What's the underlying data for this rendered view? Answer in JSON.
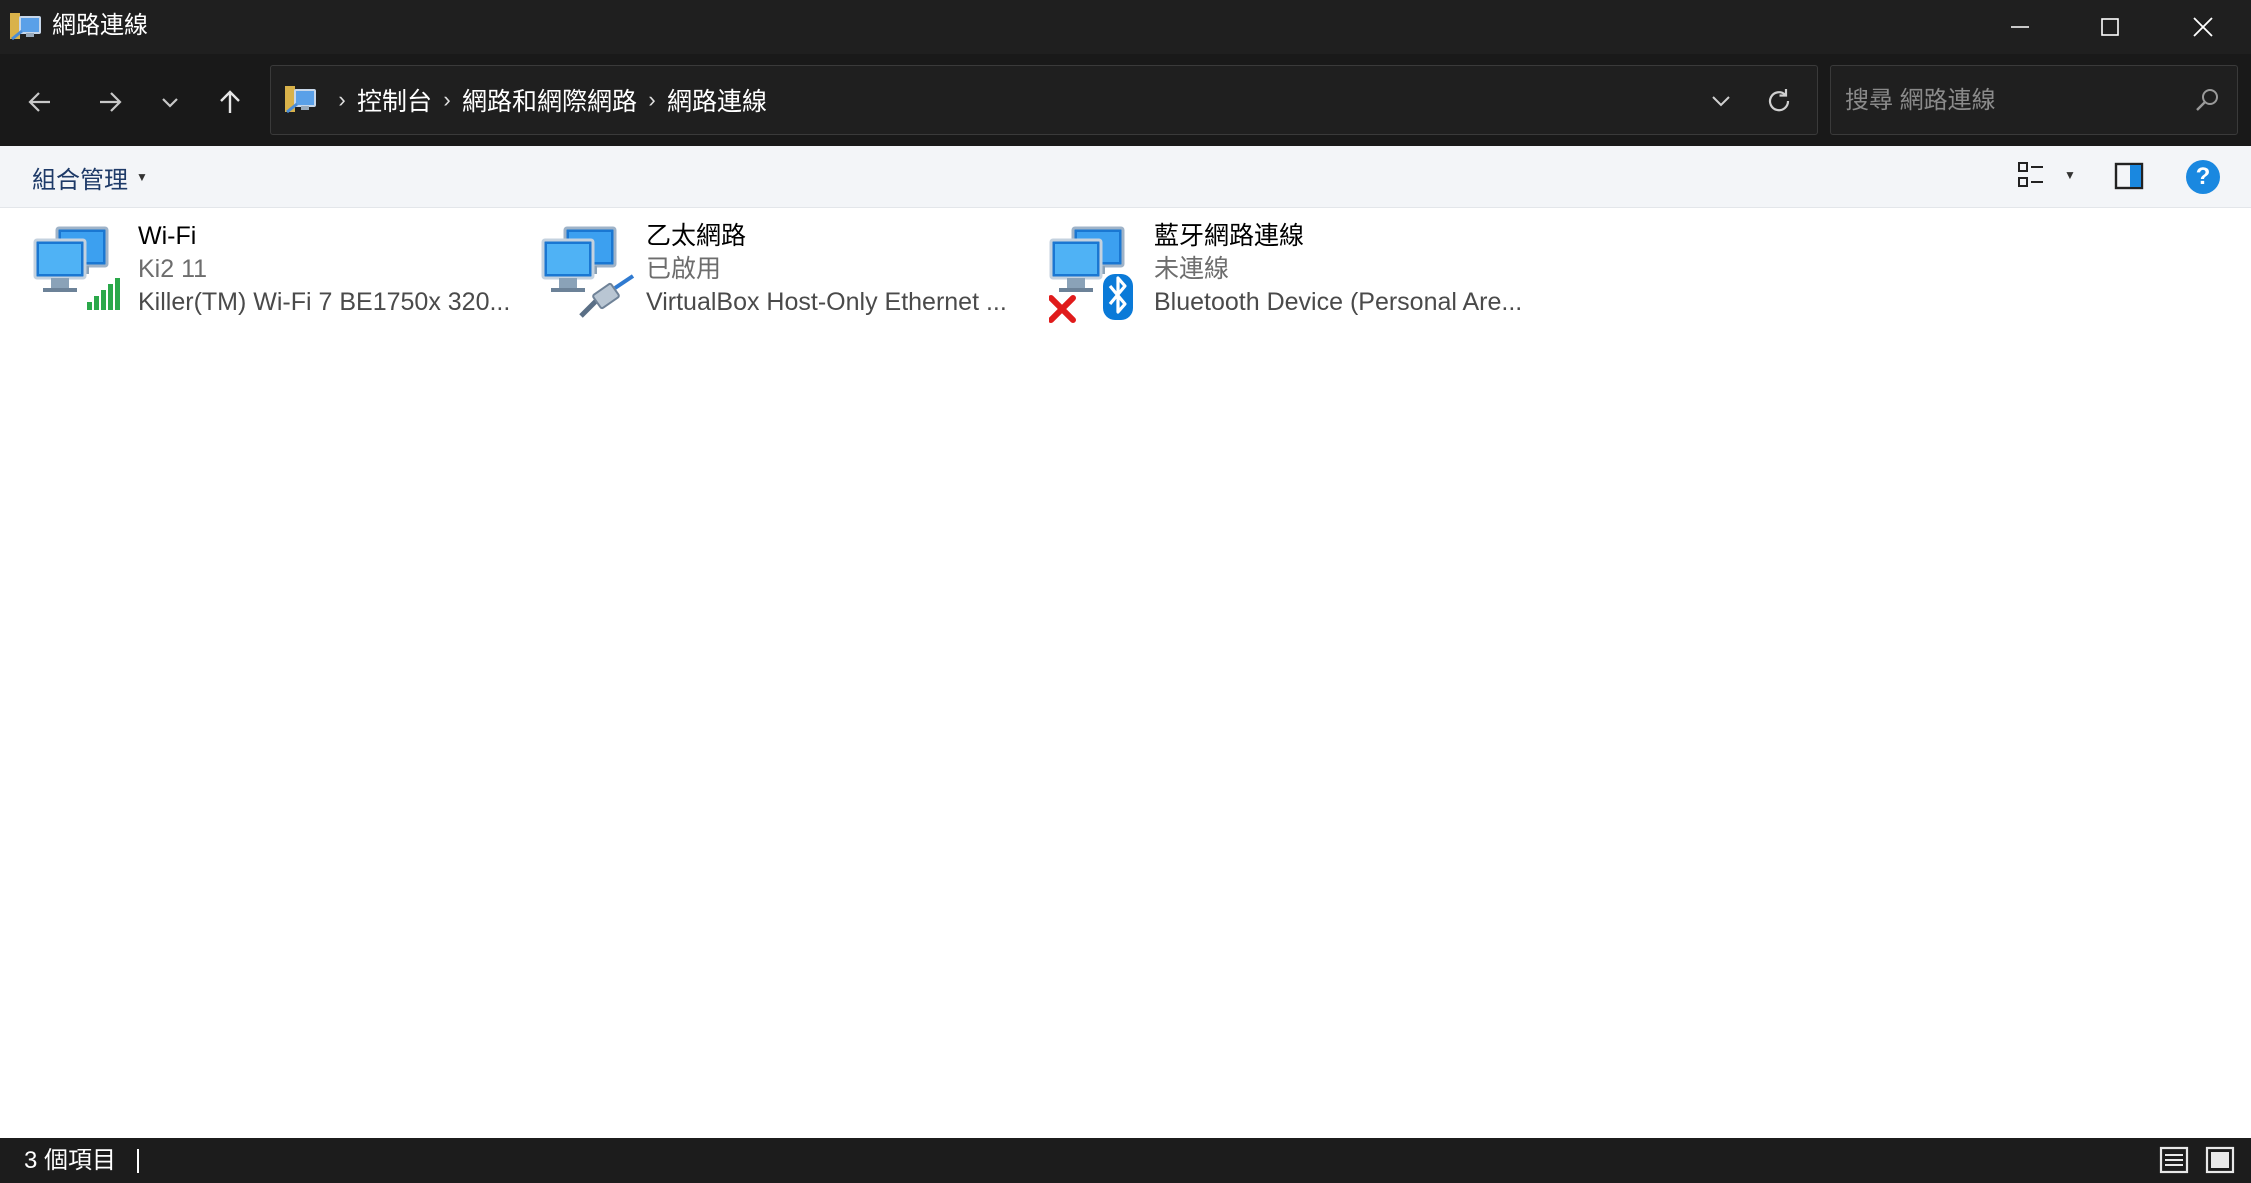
{
  "window": {
    "title": "網路連線",
    "minimize_label": "Minimize",
    "maximize_label": "Maximize",
    "close_label": "Close"
  },
  "nav": {
    "back_label": "Back",
    "forward_label": "Forward",
    "recent_label": "Recent locations",
    "up_label": "Up"
  },
  "breadcrumbs": [
    "控制台",
    "網路和網際網路",
    "網路連線"
  ],
  "search": {
    "placeholder": "搜尋 網路連線"
  },
  "toolbar": {
    "organize_label": "組合管理",
    "help_label": "?"
  },
  "connections": [
    {
      "name": "Wi-Fi",
      "status": "Ki2 11",
      "device": "Killer(TM) Wi-Fi 7 BE1750x 320...",
      "icon": "wifi-adapter-icon",
      "overlay": "signal-bars-icon"
    },
    {
      "name": "乙太網路",
      "status": "已啟用",
      "device": "VirtualBox Host-Only Ethernet ...",
      "icon": "ethernet-adapter-icon",
      "overlay": "ethernet-cable-icon"
    },
    {
      "name": "藍牙網路連線",
      "status": "未連線",
      "device": "Bluetooth Device (Personal Are...",
      "icon": "bluetooth-adapter-icon",
      "overlay": "disconnected-x-icon"
    }
  ],
  "statusbar": {
    "item_count": "3 個項目"
  },
  "colors": {
    "titlebar_bg": "#1f1f1f",
    "content_bg": "#ffffff",
    "command_bar_bg": "#f3f5f8",
    "accent": "#1a88e0",
    "signal_green": "#2aa84a",
    "error_red": "#e01b1b"
  }
}
